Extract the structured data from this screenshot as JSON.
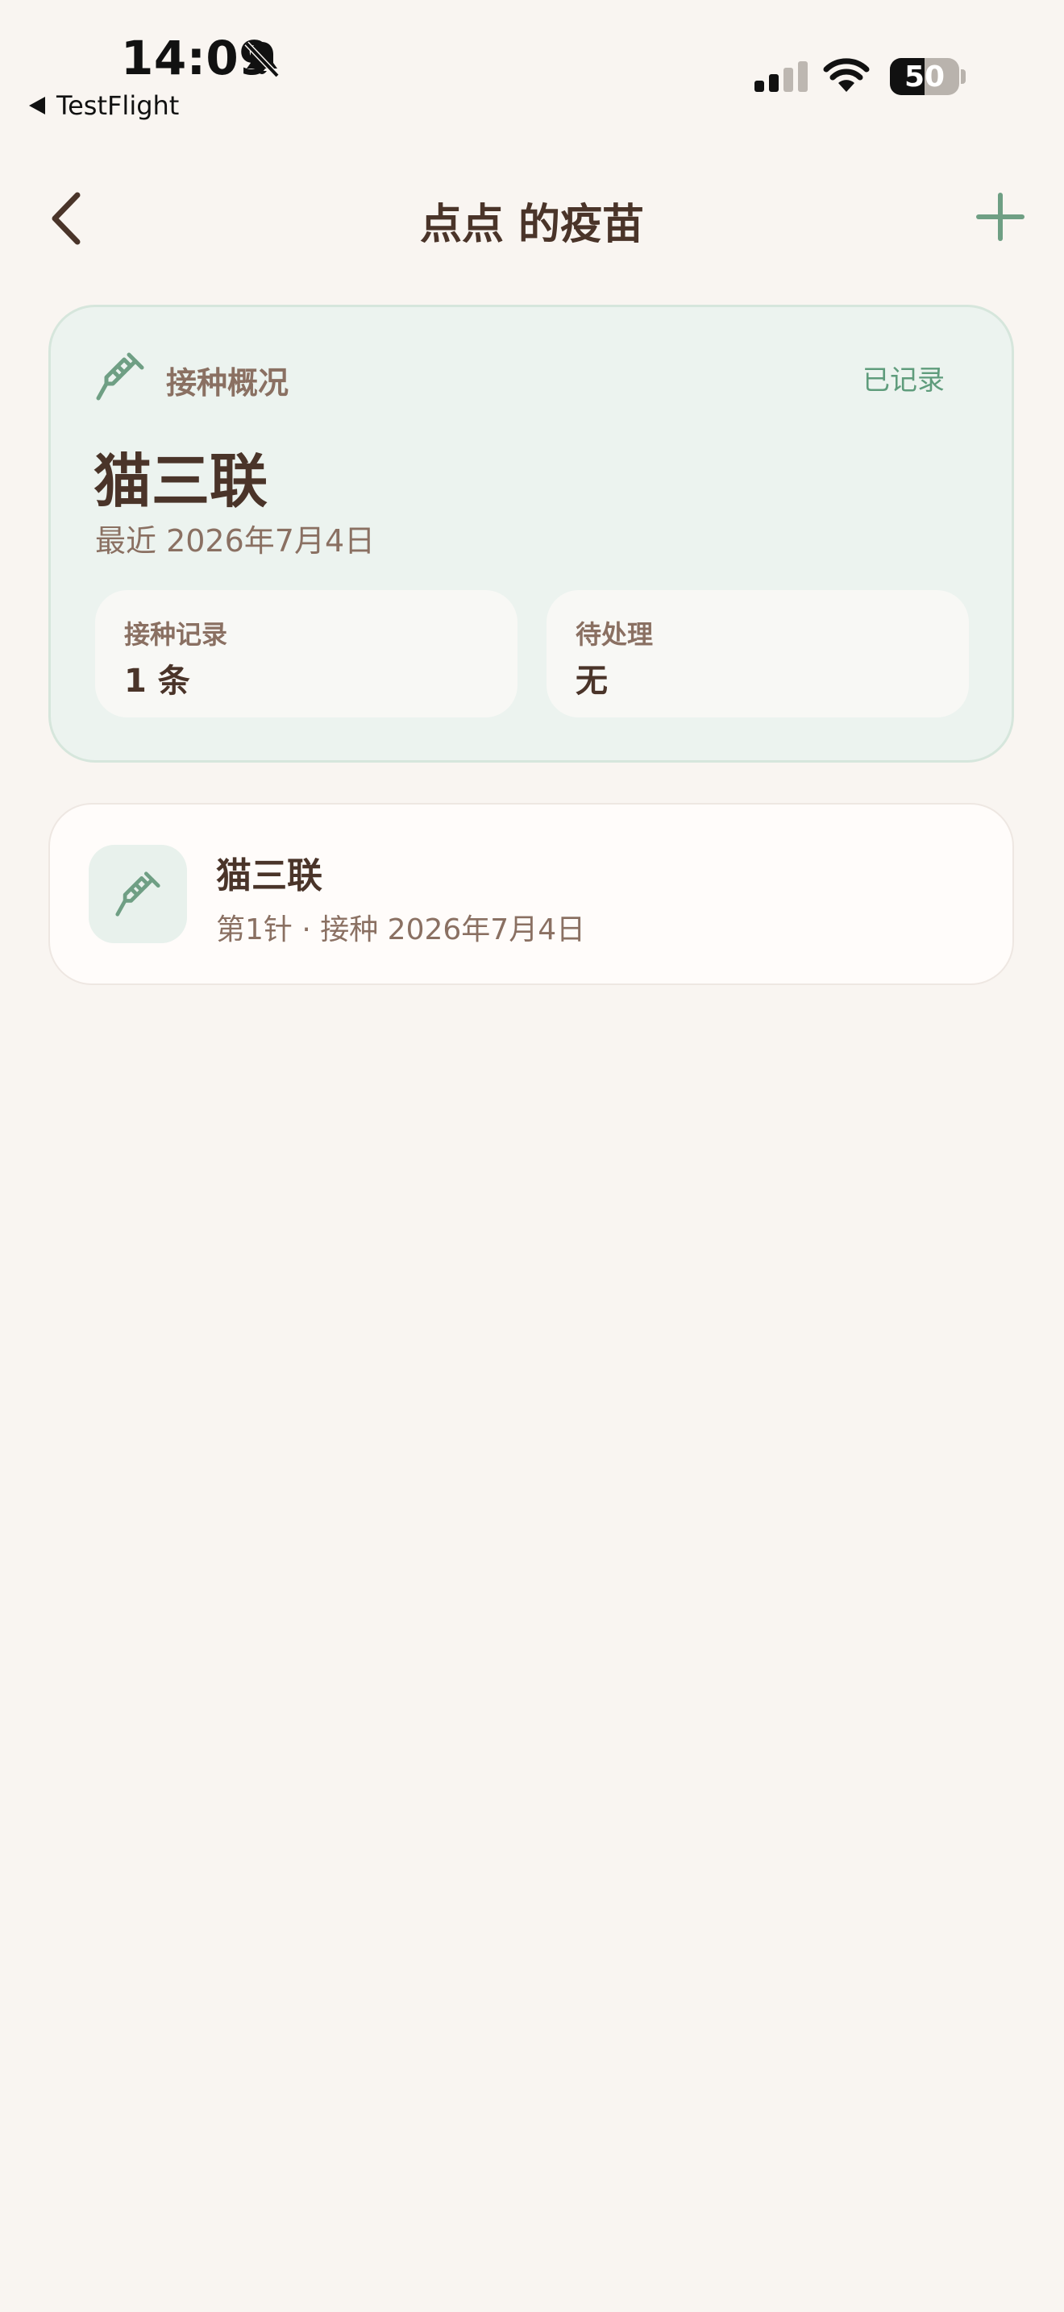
{
  "status_bar": {
    "time": "14:09",
    "back_app": "TestFlight",
    "battery": "50"
  },
  "nav": {
    "title": "点点 的疫苗"
  },
  "summary": {
    "heading": "接种概况",
    "status": "已记录",
    "vaccine_name": "猫三联",
    "recent": "最近 2026年7月4日",
    "stats": [
      {
        "label": "接种记录",
        "value": "1 条"
      },
      {
        "label": "待处理",
        "value": "无"
      }
    ]
  },
  "records": [
    {
      "title": "猫三联",
      "subtitle": "第1针 · 接种 2026年7月4日"
    }
  ],
  "colors": {
    "background": "#f9f5f1",
    "accent_green": "#6f9f84",
    "text_brown": "#4a3429",
    "muted_brown": "#8a7062"
  },
  "icons": [
    "bell-slash-icon",
    "signal-icon",
    "wifi-icon",
    "battery-icon",
    "chevron-left-icon",
    "plus-icon",
    "syringe-icon"
  ]
}
